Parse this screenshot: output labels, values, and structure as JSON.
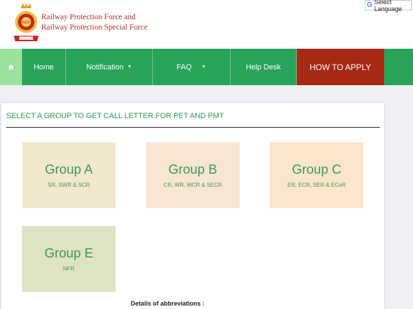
{
  "header": {
    "org_line1": "Railway Protection Force and",
    "org_line2": "Railway Protection Special Force",
    "language_button": "Select Language",
    "google_letter": "G"
  },
  "nav": {
    "items": [
      {
        "label": "Home"
      },
      {
        "label": "Notification",
        "has_caret": true
      },
      {
        "label": "FAQ",
        "has_caret": true
      },
      {
        "label": "Help Desk"
      },
      {
        "label": "HOW TO APPLY"
      }
    ],
    "caret": "▼",
    "colors": {
      "bar": "#27a35a",
      "home": "#9be29d",
      "apply": "#a52a16"
    }
  },
  "main": {
    "title": "SELECT A GROUP TO GET CALL LETTER FOR PET AND PMT",
    "groups": [
      {
        "name": "Group A",
        "zones": "SR, SWR & SCR",
        "color": "#f2e7cf"
      },
      {
        "name": "Group B",
        "zones": "CR, WR, WCR & SECR",
        "color": "#f9e6d2"
      },
      {
        "name": "Group C",
        "zones": "ER, ECR, SER & ECoR",
        "color": "#fbe5cc"
      },
      {
        "name": "Group E",
        "zones": "NFR",
        "color": "#dfe2c5"
      }
    ],
    "abbreviations_heading": "Details of abbreviations :"
  }
}
